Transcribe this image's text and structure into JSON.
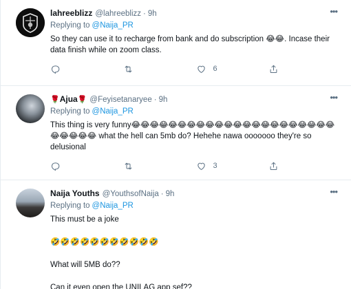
{
  "tweets": [
    {
      "name": "lahreeblizz",
      "handle": "@lahreeblizz",
      "time": "9h",
      "replying_label": "Replying to",
      "replying_to": "@Naija_PR",
      "text": "So they can use it to recharge from bank and do subscription 😂😂. Incase their data finish while on zoom class.",
      "reply_count": "",
      "retweet_count": "",
      "like_count": "6"
    },
    {
      "name_prefix": "🌹",
      "name": "Ajua",
      "name_suffix": "🌹",
      "handle": "@Feyisetanaryee",
      "time": "9h",
      "replying_label": "Replying to",
      "replying_to": "@Naija_PR",
      "text": "This thing is very funny😂😂😂😂😂😂😂😂😂😂😂😂😂😂😂😂😂😂😂😂😂😂😂😂😂😂😂 what the hell can 5mb do? Hehehe nawa ooooooo they're so delusional",
      "reply_count": "",
      "retweet_count": "",
      "like_count": "3"
    },
    {
      "name": "Naija Youths",
      "handle": "@YouthsofNaija",
      "time": "9h",
      "replying_label": "Replying to",
      "replying_to": "@Naija_PR",
      "text_1": "This must be a joke",
      "text_2": "🤣🤣🤣🤣🤣🤣🤣🤣🤣🤣🤣",
      "text_3": "What will 5MB do??",
      "text_4": "Can it even open the UNILAG app sef??"
    }
  ],
  "separator": "·",
  "more_glyph": "•••"
}
